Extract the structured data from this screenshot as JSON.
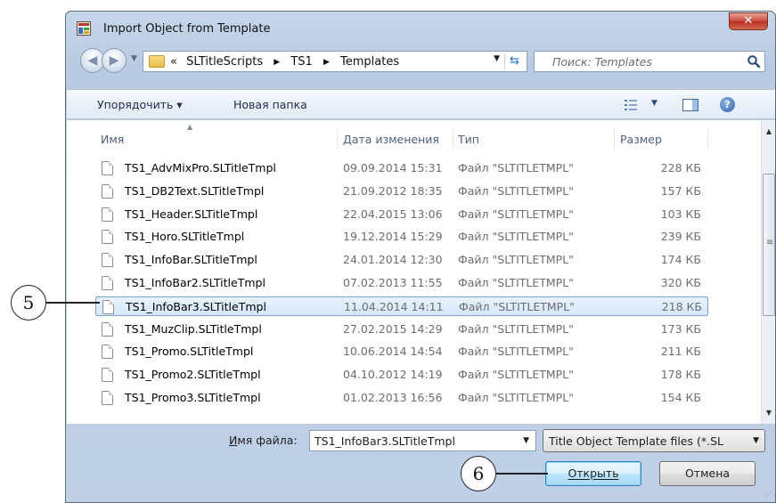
{
  "window": {
    "title": "Import Object from Template",
    "close_glyph": "✕"
  },
  "address": {
    "overflow": "«",
    "breadcrumbs": [
      "SLTitleScripts",
      "TS1",
      "Templates"
    ],
    "search_placeholder": "Поиск: Templates"
  },
  "toolbar": {
    "organize_label": "Упорядочить ▾",
    "new_folder_label": "Новая папка"
  },
  "columns": {
    "name": "Имя",
    "date": "Дата изменения",
    "type": "Тип",
    "size": "Размер"
  },
  "files": [
    {
      "name": "TS1_AdvMixPro.SLTitleTmpl",
      "date": "09.09.2014 15:31",
      "type": "Файл \"SLTITLETMPL\"",
      "size": "228 КБ"
    },
    {
      "name": "TS1_DB2Text.SLTitleTmpl",
      "date": "21.09.2012 18:35",
      "type": "Файл \"SLTITLETMPL\"",
      "size": "157 КБ"
    },
    {
      "name": "TS1_Header.SLTitleTmpl",
      "date": "22.04.2015 13:06",
      "type": "Файл \"SLTITLETMPL\"",
      "size": "103 КБ"
    },
    {
      "name": "TS1_Horo.SLTitleTmpl",
      "date": "19.12.2014 15:29",
      "type": "Файл \"SLTITLETMPL\"",
      "size": "239 КБ"
    },
    {
      "name": "TS1_InfoBar.SLTitleTmpl",
      "date": "24.01.2014 12:30",
      "type": "Файл \"SLTITLETMPL\"",
      "size": "174 КБ"
    },
    {
      "name": "TS1_InfoBar2.SLTitleTmpl",
      "date": "07.02.2013 11:55",
      "type": "Файл \"SLTITLETMPL\"",
      "size": "320 КБ"
    },
    {
      "name": "TS1_InfoBar3.SLTitleTmpl",
      "date": "11.04.2014 14:11",
      "type": "Файл \"SLTITLETMPL\"",
      "size": "218 КБ",
      "selected": true
    },
    {
      "name": "TS1_MuzClip.SLTitleTmpl",
      "date": "27.02.2015 14:29",
      "type": "Файл \"SLTITLETMPL\"",
      "size": "173 КБ"
    },
    {
      "name": "TS1_Promo.SLTitleTmpl",
      "date": "10.06.2014 14:54",
      "type": "Файл \"SLTITLETMPL\"",
      "size": "211 КБ"
    },
    {
      "name": "TS1_Promo2.SLTitleTmpl",
      "date": "04.10.2012 14:19",
      "type": "Файл \"SLTITLETMPL\"",
      "size": "178 КБ"
    },
    {
      "name": "TS1_Promo3.SLTitleTmpl",
      "date": "01.02.2013 16:56",
      "type": "Файл \"SLTITLETMPL\"",
      "size": "154 КБ"
    }
  ],
  "bottom": {
    "filename_label": "Имя файла:",
    "filename_value": "TS1_InfoBar3.SLTitleTmpl",
    "filetype_value": "Title Object Template files (*.SL",
    "open_label": "Открыть",
    "cancel_label": "Отмена"
  },
  "callouts": {
    "row": "5",
    "open": "6"
  },
  "colors": {
    "selection_border": "#7da2ce",
    "accent": "#3c7fb1"
  }
}
